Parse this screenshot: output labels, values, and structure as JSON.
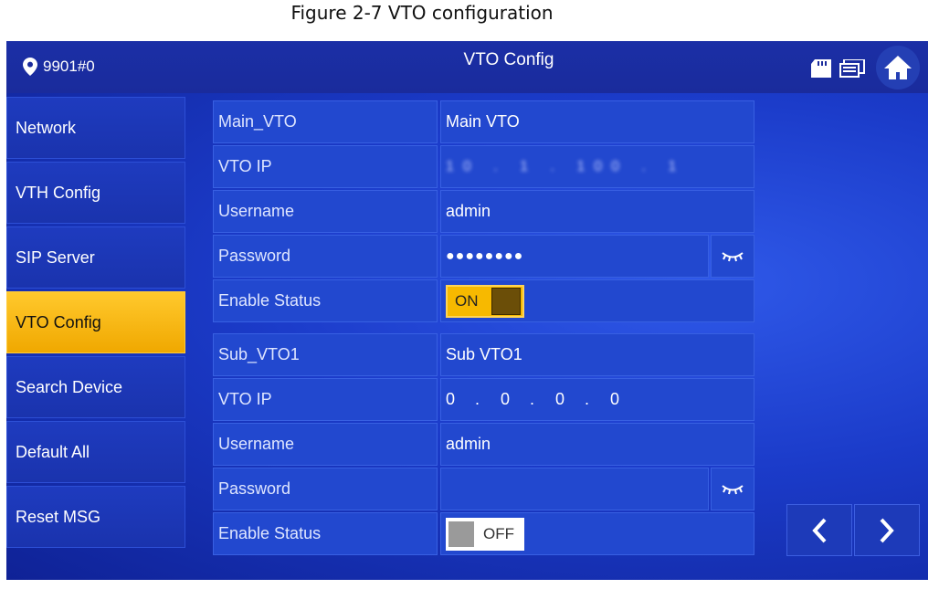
{
  "caption": "Figure 2-7 VTO configuration",
  "header": {
    "location": "9901#0",
    "title": "VTO Config",
    "icons": [
      "location-pin-icon",
      "sd-card-icon",
      "monitor-icon",
      "home-icon"
    ]
  },
  "sidebar": {
    "items": [
      {
        "label": "Network"
      },
      {
        "label": "VTH Config"
      },
      {
        "label": "SIP Server"
      },
      {
        "label": "VTO Config",
        "active": true
      },
      {
        "label": "Search Device"
      },
      {
        "label": "Default All"
      },
      {
        "label": "Reset MSG"
      }
    ]
  },
  "main_vto": {
    "name_label": "Main_VTO",
    "name_value": "Main VTO",
    "ip_label": "VTO IP",
    "ip_value": "10 . 1 . 100 . 1",
    "username_label": "Username",
    "username_value": "admin",
    "password_label": "Password",
    "password_value": "●●●●●●●●",
    "status_label": "Enable Status",
    "status_value": "ON"
  },
  "sub_vto": {
    "name_label": "Sub_VTO1",
    "name_value": "Sub VTO1",
    "ip_label": "VTO IP",
    "ip_octets": [
      "0",
      ".",
      "0",
      ".",
      "0",
      ".",
      "0"
    ],
    "username_label": "Username",
    "username_value": "admin",
    "password_label": "Password",
    "password_value": "",
    "status_label": "Enable Status",
    "status_value": "OFF"
  },
  "nav": {
    "prev": "prev-icon",
    "next": "next-icon"
  },
  "colors": {
    "accent": "#f7b900",
    "panel": "#2248cf",
    "background": "#1b3bc9"
  }
}
